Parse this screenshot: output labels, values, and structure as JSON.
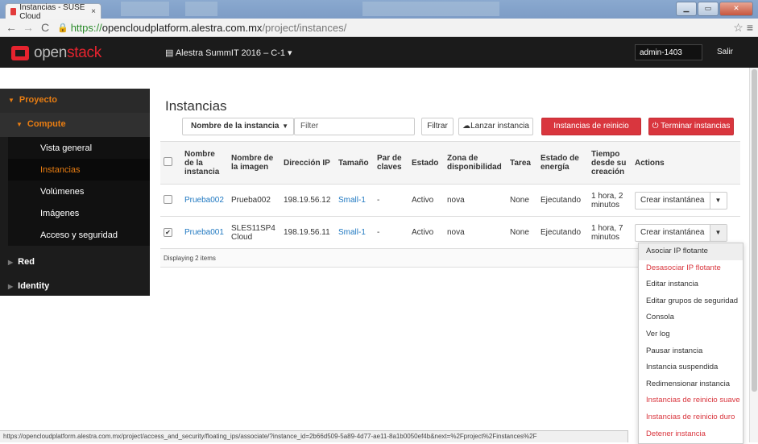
{
  "browser": {
    "tab_title": "Instancias - SUSE Cloud",
    "tab_close": "×",
    "url_scheme": "https://",
    "url_host": "opencloudplatform.alestra.com.mx",
    "url_path": "/project/instances/",
    "window_buttons": [
      "▁",
      "▭",
      "✕"
    ]
  },
  "header": {
    "logo_prefix": "open",
    "logo_suffix": "stack",
    "project_selector": "Alestra SummIT 2016 – C-1 ▾",
    "user": "admin-1403",
    "logout": "Salir"
  },
  "sidebar": {
    "proyecto": "Proyecto",
    "compute": "Compute",
    "items": [
      "Vista general",
      "Instancias",
      "Volúmenes",
      "Imágenes",
      "Acceso y seguridad"
    ],
    "active_index": 1,
    "red": "Red",
    "identity": "Identity"
  },
  "main": {
    "title": "Instancias",
    "filter_select": "Nombre de la instancia",
    "filter_placeholder": "Filter",
    "filter_button": "Filtrar",
    "launch_button": "Lanzar instancia",
    "soft_reboot_button": "Instancias de reinicio suave",
    "terminate_button": "Terminar instancias"
  },
  "table": {
    "headers": [
      "Nombre de la instancia",
      "Nombre de la imagen",
      "Dirección IP",
      "Tamaño",
      "Par de claves",
      "Estado",
      "Zona de disponibilidad",
      "Tarea",
      "Estado de energía",
      "Tiempo desde su creación",
      "Actions"
    ],
    "rows": [
      {
        "checked": false,
        "name": "Prueba002",
        "image": "Prueba002",
        "ip": "198.19.56.12",
        "size": "Small-1",
        "keypair": "-",
        "status": "Activo",
        "zone": "nova",
        "task": "None",
        "power": "Ejecutando",
        "time": "1 hora, 2 minutos",
        "action": "Crear instantánea"
      },
      {
        "checked": true,
        "name": "Prueba001",
        "image": "SLES11SP4 Cloud",
        "ip": "198.19.56.11",
        "size": "Small-1",
        "keypair": "-",
        "status": "Activo",
        "zone": "nova",
        "task": "None",
        "power": "Ejecutando",
        "time": "1 hora, 7 minutos",
        "action": "Crear instantánea"
      }
    ],
    "footer": "Displaying 2 items"
  },
  "dropdown": {
    "items": [
      {
        "label": "Asociar IP flotante",
        "danger": false
      },
      {
        "label": "Desasociar IP flotante",
        "danger": true
      },
      {
        "label": "Editar instancia",
        "danger": false
      },
      {
        "label": "Editar grupos de seguridad",
        "danger": false
      },
      {
        "label": "Consola",
        "danger": false
      },
      {
        "label": "Ver log",
        "danger": false
      },
      {
        "label": "Pausar instancia",
        "danger": false
      },
      {
        "label": "Instancia suspendida",
        "danger": false
      },
      {
        "label": "Redimensionar instancia",
        "danger": false
      },
      {
        "label": "Instancias de reinicio suave",
        "danger": true
      },
      {
        "label": "Instancias de reinicio duro",
        "danger": true
      },
      {
        "label": "Detener instancia",
        "danger": true
      }
    ],
    "hover_index": 0
  },
  "status_url": "https://opencloudplatform.alestra.com.mx/project/access_and_security/floating_ips/associate/?instance_id=2b66d509-5a89-4d77-ae11-8a1b0050ef4b&next=%2Fproject%2Finstances%2F",
  "colors": {
    "accent": "#e87d12",
    "danger": "#d9363e",
    "link": "#1f78c1",
    "header_bg": "#1b1b1b"
  }
}
